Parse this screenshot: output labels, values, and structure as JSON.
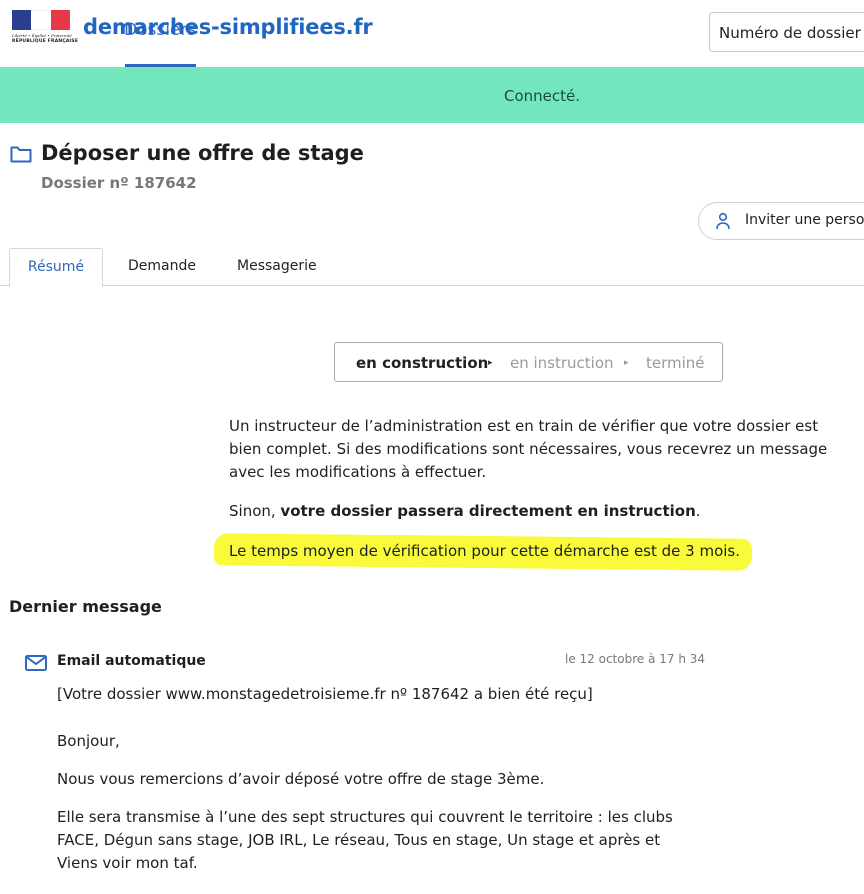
{
  "header": {
    "marianne": {
      "motto": "Liberté • Égalité • Fraternité",
      "republic": "RÉPUBLIQUE FRANÇAISE"
    },
    "tab_dossiers": "Dossiers",
    "brand": "demarches-simplifiees.fr",
    "dossier_search_placeholder": "Numéro de dossier"
  },
  "flash": {
    "message": "Connecté."
  },
  "dossier": {
    "title": "Déposer une offre de stage",
    "number": "Dossier nº 187642",
    "invite_label": "Inviter une personne"
  },
  "tabs": [
    {
      "label": "Résumé",
      "active": true
    },
    {
      "label": "Demande",
      "active": false
    },
    {
      "label": "Messagerie",
      "active": false
    }
  ],
  "status": {
    "steps": [
      "en construction",
      "en instruction",
      "terminé"
    ],
    "arrow": "▸"
  },
  "summary": {
    "p1": "Un instructeur de l’administration est en train de vérifier que votre dossier est bien complet. Si des modifications sont nécessaires, vous recevrez un message avec les modifications à effectuer.",
    "p2_prefix": "Sinon, ",
    "p2_bold": "votre dossier passera directement en instruction",
    "p2_suffix": ".",
    "p3": "Le temps moyen de vérification pour cette démarche est de 3 mois."
  },
  "last_message": {
    "section_title": "Dernier message",
    "author": "Email automatique",
    "date": "le 12 octobre à 17 h 34",
    "lines": [
      "[Votre dossier www.monstagedetroisieme.fr nº 187642 a bien été reçu]",
      "Bonjour,",
      "Nous vous remercions d’avoir déposé votre offre de stage 3ème.",
      "Elle sera transmise à l’une des sept structures qui couvrent le territoire : les clubs FACE, Dégun sans stage, JOB IRL, Le réseau, Tous en stage, Un stage et après et Viens voir mon taf."
    ]
  },
  "colors": {
    "brand_blue": "#1f66c2",
    "flash_green": "#72e6bd",
    "highlight_yellow": "#f8fa3a"
  }
}
